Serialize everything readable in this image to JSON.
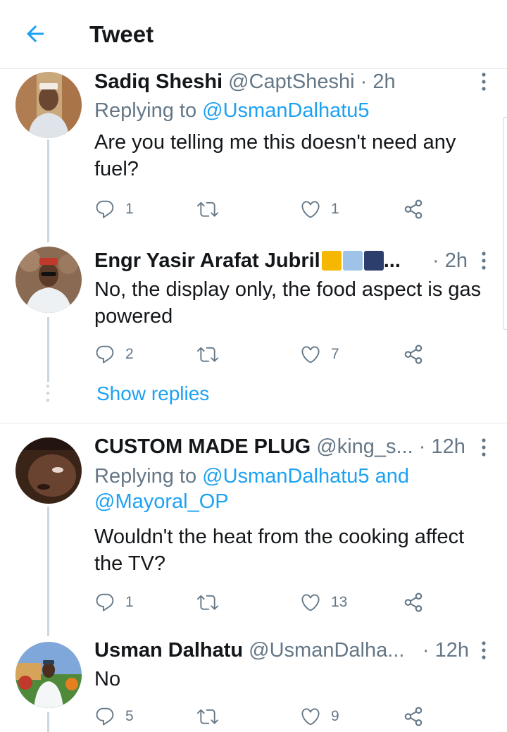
{
  "header": {
    "title": "Tweet"
  },
  "tweets": [
    {
      "name": "Sadiq Sheshi",
      "handle": "@CaptSheshi",
      "time": "· 2h",
      "replying_prefix": "Replying to",
      "replying_to": "@UsmanDalhatu5",
      "text": "Are you telling me this doesn't need any fuel?",
      "replies": "1",
      "retweets": "",
      "likes": "1"
    },
    {
      "name": "Engr Yasir Arafat Jubril",
      "name_suffix": "...",
      "handle": "",
      "time": "· 2h",
      "text": "No, the display only, the food aspect is gas powered",
      "replies": "2",
      "retweets": "",
      "likes": "7",
      "show_replies": "Show replies"
    },
    {
      "name": "CUSTOM MADE PLUG",
      "handle": "@king_s...",
      "time": "· 12h",
      "replying_prefix": "Replying to",
      "replying_to": "@UsmanDalhatu5",
      "replying_and": "and",
      "replying_to_2": "@Mayoral_OP",
      "text": "Wouldn't the heat from the cooking affect the TV?",
      "replies": "1",
      "retweets": "",
      "likes": "13"
    },
    {
      "name": "Usman Dalhatu",
      "handle": "@UsmanDalha...",
      "time": "· 12h",
      "text": "No",
      "replies": "5",
      "retweets": "",
      "likes": "9"
    }
  ],
  "colors": {
    "accent": "#1da1f2",
    "muted": "#657786",
    "text": "#14171a",
    "border": "#e1e8ed"
  },
  "icons": [
    "back-arrow-icon",
    "more-vertical-icon",
    "reply-icon",
    "retweet-icon",
    "like-icon",
    "share-icon"
  ]
}
